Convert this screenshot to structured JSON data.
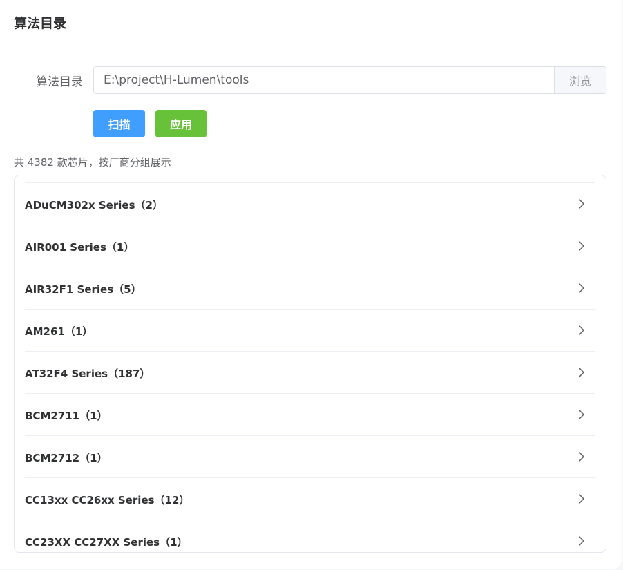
{
  "header": {
    "title": "算法目录"
  },
  "form": {
    "label": "算法目录",
    "path_value": "E:\\project\\H-Lumen\\tools",
    "browse_label": "浏览"
  },
  "buttons": {
    "scan_label": "扫描",
    "apply_label": "应用"
  },
  "summary": "共 4382 款芯片，按厂商分组展示",
  "groups": [
    {
      "label": "ADuCM302x Series（2）"
    },
    {
      "label": "AIR001 Series（1）"
    },
    {
      "label": "AIR32F1 Series（5）"
    },
    {
      "label": "AM261（1）"
    },
    {
      "label": "AT32F4 Series（187）"
    },
    {
      "label": "BCM2711（1）"
    },
    {
      "label": "BCM2712（1）"
    },
    {
      "label": "CC13xx CC26xx Series（12）"
    },
    {
      "label": "CC23XX CC27XX Series（1）"
    }
  ],
  "icons": {
    "chevron": "chevron-right-icon"
  },
  "colors": {
    "primary": "#409eff",
    "success": "#67c23a",
    "text": "#303133",
    "border": "#e4e7ed"
  }
}
